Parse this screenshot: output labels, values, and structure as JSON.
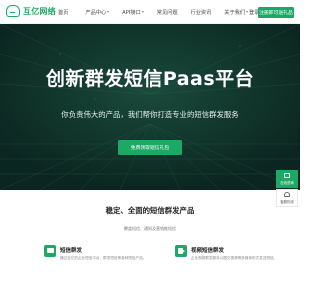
{
  "header": {
    "logo_text": "互亿网络",
    "nav": [
      {
        "label": "首页",
        "has_caret": false
      },
      {
        "label": "产品中心",
        "has_caret": true
      },
      {
        "label": "API接口",
        "has_caret": true
      },
      {
        "label": "常见问题",
        "has_caret": false
      },
      {
        "label": "行业资讯",
        "has_caret": false
      },
      {
        "label": "关于我们",
        "has_caret": true
      }
    ],
    "login_label": "登录",
    "register_label": "注册即可送礼品"
  },
  "hero": {
    "title": "创新群发短信Paas平台",
    "subtitle": "你负责伟大的产品，我们帮你打造专业的短信群发服务",
    "cta_label": "免费领取短信礼包"
  },
  "products": {
    "title": "稳定、全面的短信群发产品",
    "subtitle": "覆盖短信、通知及营销推短信",
    "cards": [
      {
        "icon": "sms-icon",
        "title": "短信群发",
        "desc": "通过互亿的企业短信平台，群发短信等各种短信产品。"
      },
      {
        "icon": "video-icon",
        "title": "视频短信群发",
        "desc": "企业视频群发服务以图文视频等多媒体形式发送短信。"
      }
    ]
  },
  "float_bar": {
    "items": [
      {
        "label": "在线咨询",
        "style": "green"
      },
      {
        "label": "客服热线",
        "style": "white"
      }
    ]
  },
  "colors": {
    "brand": "#1ea866",
    "hero_bg": "#0e2d25"
  }
}
